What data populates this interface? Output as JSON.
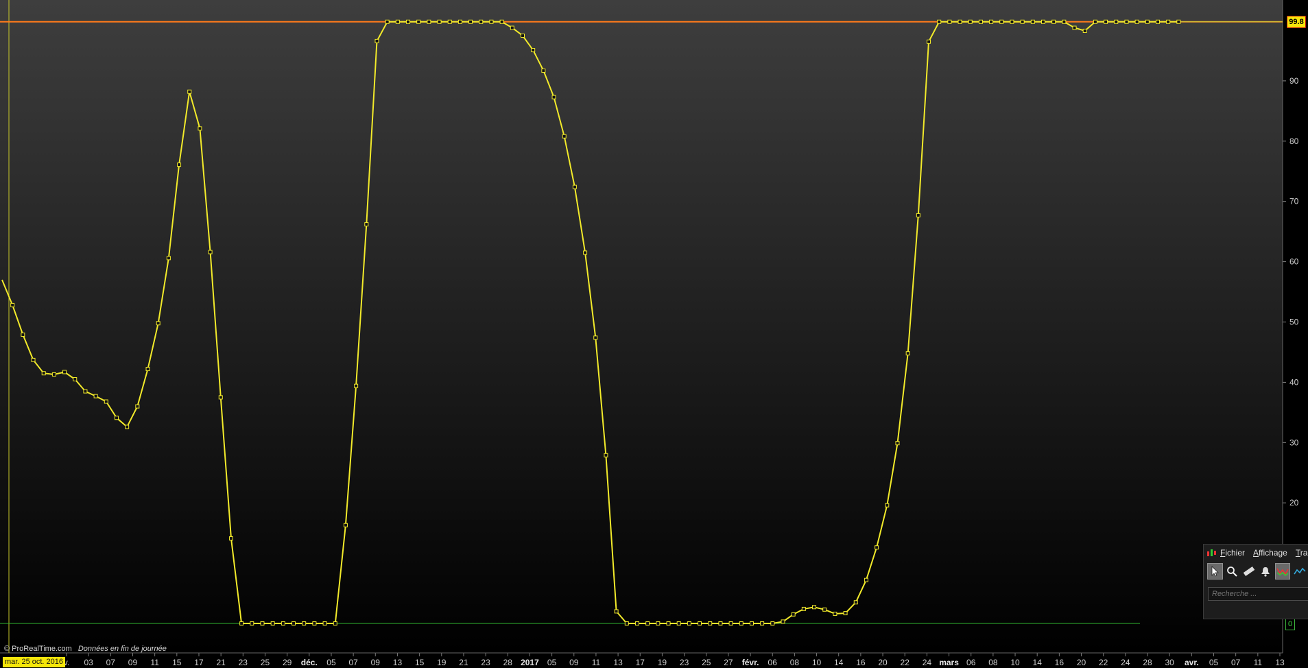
{
  "chart_data": {
    "type": "line",
    "ylim": [
      0,
      100
    ],
    "y_ticks": [
      0,
      20,
      30,
      40,
      50,
      60,
      70,
      80,
      90
    ],
    "x_ticks": [
      {
        "label": "v.",
        "bold": false
      },
      {
        "label": "03",
        "bold": false
      },
      {
        "label": "07",
        "bold": false
      },
      {
        "label": "09",
        "bold": false
      },
      {
        "label": "11",
        "bold": false
      },
      {
        "label": "15",
        "bold": false
      },
      {
        "label": "17",
        "bold": false
      },
      {
        "label": "21",
        "bold": false
      },
      {
        "label": "23",
        "bold": false
      },
      {
        "label": "25",
        "bold": false
      },
      {
        "label": "29",
        "bold": false
      },
      {
        "label": "déc.",
        "bold": true
      },
      {
        "label": "05",
        "bold": false
      },
      {
        "label": "07",
        "bold": false
      },
      {
        "label": "09",
        "bold": false
      },
      {
        "label": "13",
        "bold": false
      },
      {
        "label": "15",
        "bold": false
      },
      {
        "label": "19",
        "bold": false
      },
      {
        "label": "21",
        "bold": false
      },
      {
        "label": "23",
        "bold": false
      },
      {
        "label": "28",
        "bold": false
      },
      {
        "label": "2017",
        "bold": true
      },
      {
        "label": "05",
        "bold": false
      },
      {
        "label": "09",
        "bold": false
      },
      {
        "label": "11",
        "bold": false
      },
      {
        "label": "13",
        "bold": false
      },
      {
        "label": "17",
        "bold": false
      },
      {
        "label": "19",
        "bold": false
      },
      {
        "label": "23",
        "bold": false
      },
      {
        "label": "25",
        "bold": false
      },
      {
        "label": "27",
        "bold": false
      },
      {
        "label": "févr.",
        "bold": true
      },
      {
        "label": "06",
        "bold": false
      },
      {
        "label": "08",
        "bold": false
      },
      {
        "label": "10",
        "bold": false
      },
      {
        "label": "14",
        "bold": false
      },
      {
        "label": "16",
        "bold": false
      },
      {
        "label": "20",
        "bold": false
      },
      {
        "label": "22",
        "bold": false
      },
      {
        "label": "24",
        "bold": false
      },
      {
        "label": "mars",
        "bold": true
      },
      {
        "label": "06",
        "bold": false
      },
      {
        "label": "08",
        "bold": false
      },
      {
        "label": "10",
        "bold": false
      },
      {
        "label": "14",
        "bold": false
      },
      {
        "label": "16",
        "bold": false
      },
      {
        "label": "20",
        "bold": false
      },
      {
        "label": "22",
        "bold": false
      },
      {
        "label": "24",
        "bold": false
      },
      {
        "label": "28",
        "bold": false
      },
      {
        "label": "30",
        "bold": false
      },
      {
        "label": "avr.",
        "bold": true
      },
      {
        "label": "05",
        "bold": false
      },
      {
        "label": "07",
        "bold": false
      },
      {
        "label": "11",
        "bold": false
      },
      {
        "label": "13",
        "bold": false
      }
    ],
    "series": [
      {
        "color": "#f2ea2a",
        "values": [
          57.0,
          52.8,
          47.9,
          43.7,
          41.5,
          41.3,
          41.7,
          40.5,
          38.5,
          37.7,
          36.8,
          34.1,
          32.6,
          36.0,
          42.2,
          49.8,
          60.6,
          76.1,
          88.2,
          82.1,
          61.6,
          37.5,
          14.1,
          0,
          0,
          0,
          0,
          0,
          0,
          0,
          0,
          0,
          0,
          16.3,
          39.4,
          66.2,
          96.6,
          99.8,
          99.8,
          99.8,
          99.8,
          99.8,
          99.8,
          99.8,
          99.8,
          99.8,
          99.8,
          99.8,
          99.8,
          98.8,
          97.5,
          95.1,
          91.7,
          87.3,
          80.8,
          72.4,
          61.5,
          47.4,
          27.9,
          2.0,
          0,
          0,
          0,
          0,
          0,
          0,
          0,
          0,
          0,
          0,
          0,
          0,
          0,
          0,
          0,
          0.3,
          1.5,
          2.4,
          2.7,
          2.3,
          1.6,
          1.7,
          3.5,
          7.2,
          12.6,
          19.6,
          29.9,
          44.8,
          67.7,
          96.5,
          99.8,
          99.8,
          99.8,
          99.8,
          99.8,
          99.8,
          99.8,
          99.8,
          99.8,
          99.8,
          99.8,
          99.8,
          99.8,
          98.8,
          98.3,
          99.8,
          99.8,
          99.8,
          99.8,
          99.8,
          99.8,
          99.8,
          99.8,
          99.8
        ]
      }
    ],
    "reference_lines": [
      {
        "value": 99.8,
        "color": "#ff7a1a"
      },
      {
        "value": 0,
        "color": "#2fb52f"
      }
    ],
    "last_value_label": "99.8",
    "zero_label": "0"
  },
  "footer": {
    "copyright": "© ProRealTime.com",
    "data_note": "Données en fin de journée",
    "cursor_date": "mar. 25 oct. 2016"
  },
  "toolbar": {
    "menu": [
      "Fichier",
      "Affichage",
      "Trac"
    ],
    "tools": [
      "cursor-icon",
      "zoom-icon",
      "ruler-icon",
      "alert-icon",
      "indicator-icon",
      "indicator-icon-2"
    ],
    "search_placeholder": "Recherche ..."
  },
  "colors": {
    "line": "#f2ea2a",
    "resistance": "#ff7a1a",
    "support": "#2fb52f",
    "price_badge": "#f5e60a"
  }
}
